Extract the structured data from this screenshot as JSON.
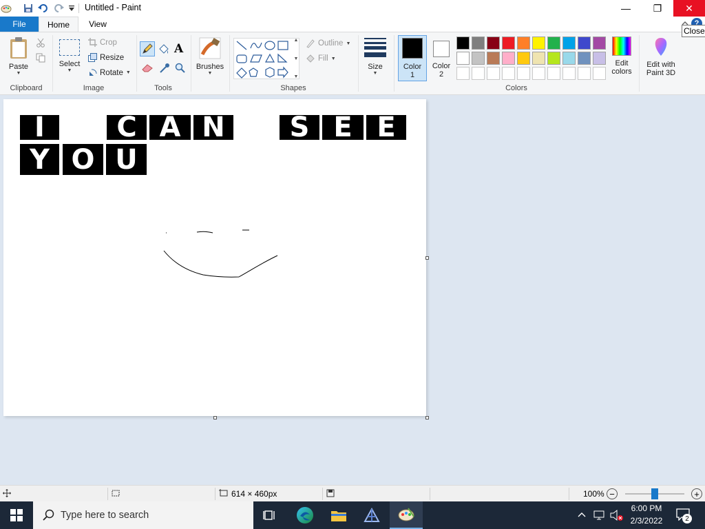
{
  "window": {
    "title": "Untitled - Paint"
  },
  "title_buttons": {
    "minimize": "—",
    "maximize": "❐",
    "close": "✕"
  },
  "tabs": {
    "file": "File",
    "home": "Home",
    "view": "View"
  },
  "tooltip": "Close",
  "ribbon": {
    "clipboard": {
      "label": "Clipboard",
      "paste": "Paste"
    },
    "image": {
      "label": "Image",
      "select": "Select",
      "crop": "Crop",
      "resize": "Resize",
      "rotate": "Rotate"
    },
    "tools": {
      "label": "Tools"
    },
    "brushes": {
      "label": "Brushes"
    },
    "shapes": {
      "label": "Shapes",
      "outline": "Outline",
      "fill": "Fill"
    },
    "size": {
      "label": "Size"
    },
    "colors": {
      "label": "Colors",
      "color1": "Color",
      "color1_num": "1",
      "color2": "Color",
      "color2_num": "2",
      "edit_colors_1": "Edit",
      "edit_colors_2": "colors",
      "paint3d_1": "Edit with",
      "paint3d_2": "Paint 3D",
      "row1": [
        "#000000",
        "#7f7f7f",
        "#880015",
        "#ed1c24",
        "#ff7f27",
        "#fff200",
        "#22b14c",
        "#00a2e8",
        "#3f48cc",
        "#a349a4"
      ],
      "row2": [
        "#ffffff",
        "#c3c3c3",
        "#b97a57",
        "#ffaec9",
        "#ffc90e",
        "#efe4b0",
        "#b5e61d",
        "#99d9ea",
        "#7092be",
        "#c8bfe7"
      ]
    }
  },
  "canvas": {
    "letters": [
      "I",
      "C",
      "A",
      "N",
      "S",
      "E",
      "E",
      "Y",
      "O",
      "U"
    ]
  },
  "status": {
    "dimensions": "614 × 460px",
    "zoom": "100%"
  },
  "taskbar": {
    "search_placeholder": "Type here to search",
    "time": "6:00 PM",
    "date": "2/3/2022",
    "notifications": "2"
  }
}
